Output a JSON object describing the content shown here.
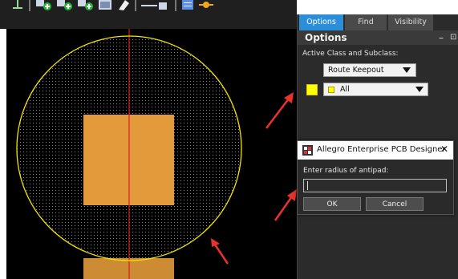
{
  "colors": {
    "canvas_bg": "#000000",
    "keepout_outline": "#f3e400",
    "pad_fill": "#e39a3a",
    "axis_line": "#d81d1d",
    "arrow": "#e8322a",
    "tab_active": "#2d8ed8",
    "swatch": "#ffff00"
  },
  "toolbar": {
    "icons": [
      "pin-icon",
      "add-via-icon",
      "add-shape-icon",
      "add-keepout-icon",
      "image-icon",
      "eraser-icon",
      "measure-icon",
      "table-icon",
      "sun-icon"
    ]
  },
  "panel": {
    "tabs": [
      {
        "label": "Options",
        "active": true
      },
      {
        "label": "Find",
        "active": false
      },
      {
        "label": "Visibility",
        "active": false
      }
    ],
    "title": "Options",
    "min_glyph": "–",
    "pin_glyph": "⊡",
    "section_label": "Active Class and Subclass:",
    "class_value": "Route Keepout",
    "subclass_value": "All"
  },
  "dialog": {
    "title": "Allegro Enterprise PCB Designer",
    "close_glyph": "✕",
    "prompt": "Enter radius of antipad:",
    "input_value": "",
    "ok_label": "OK",
    "cancel_label": "Cancel"
  }
}
